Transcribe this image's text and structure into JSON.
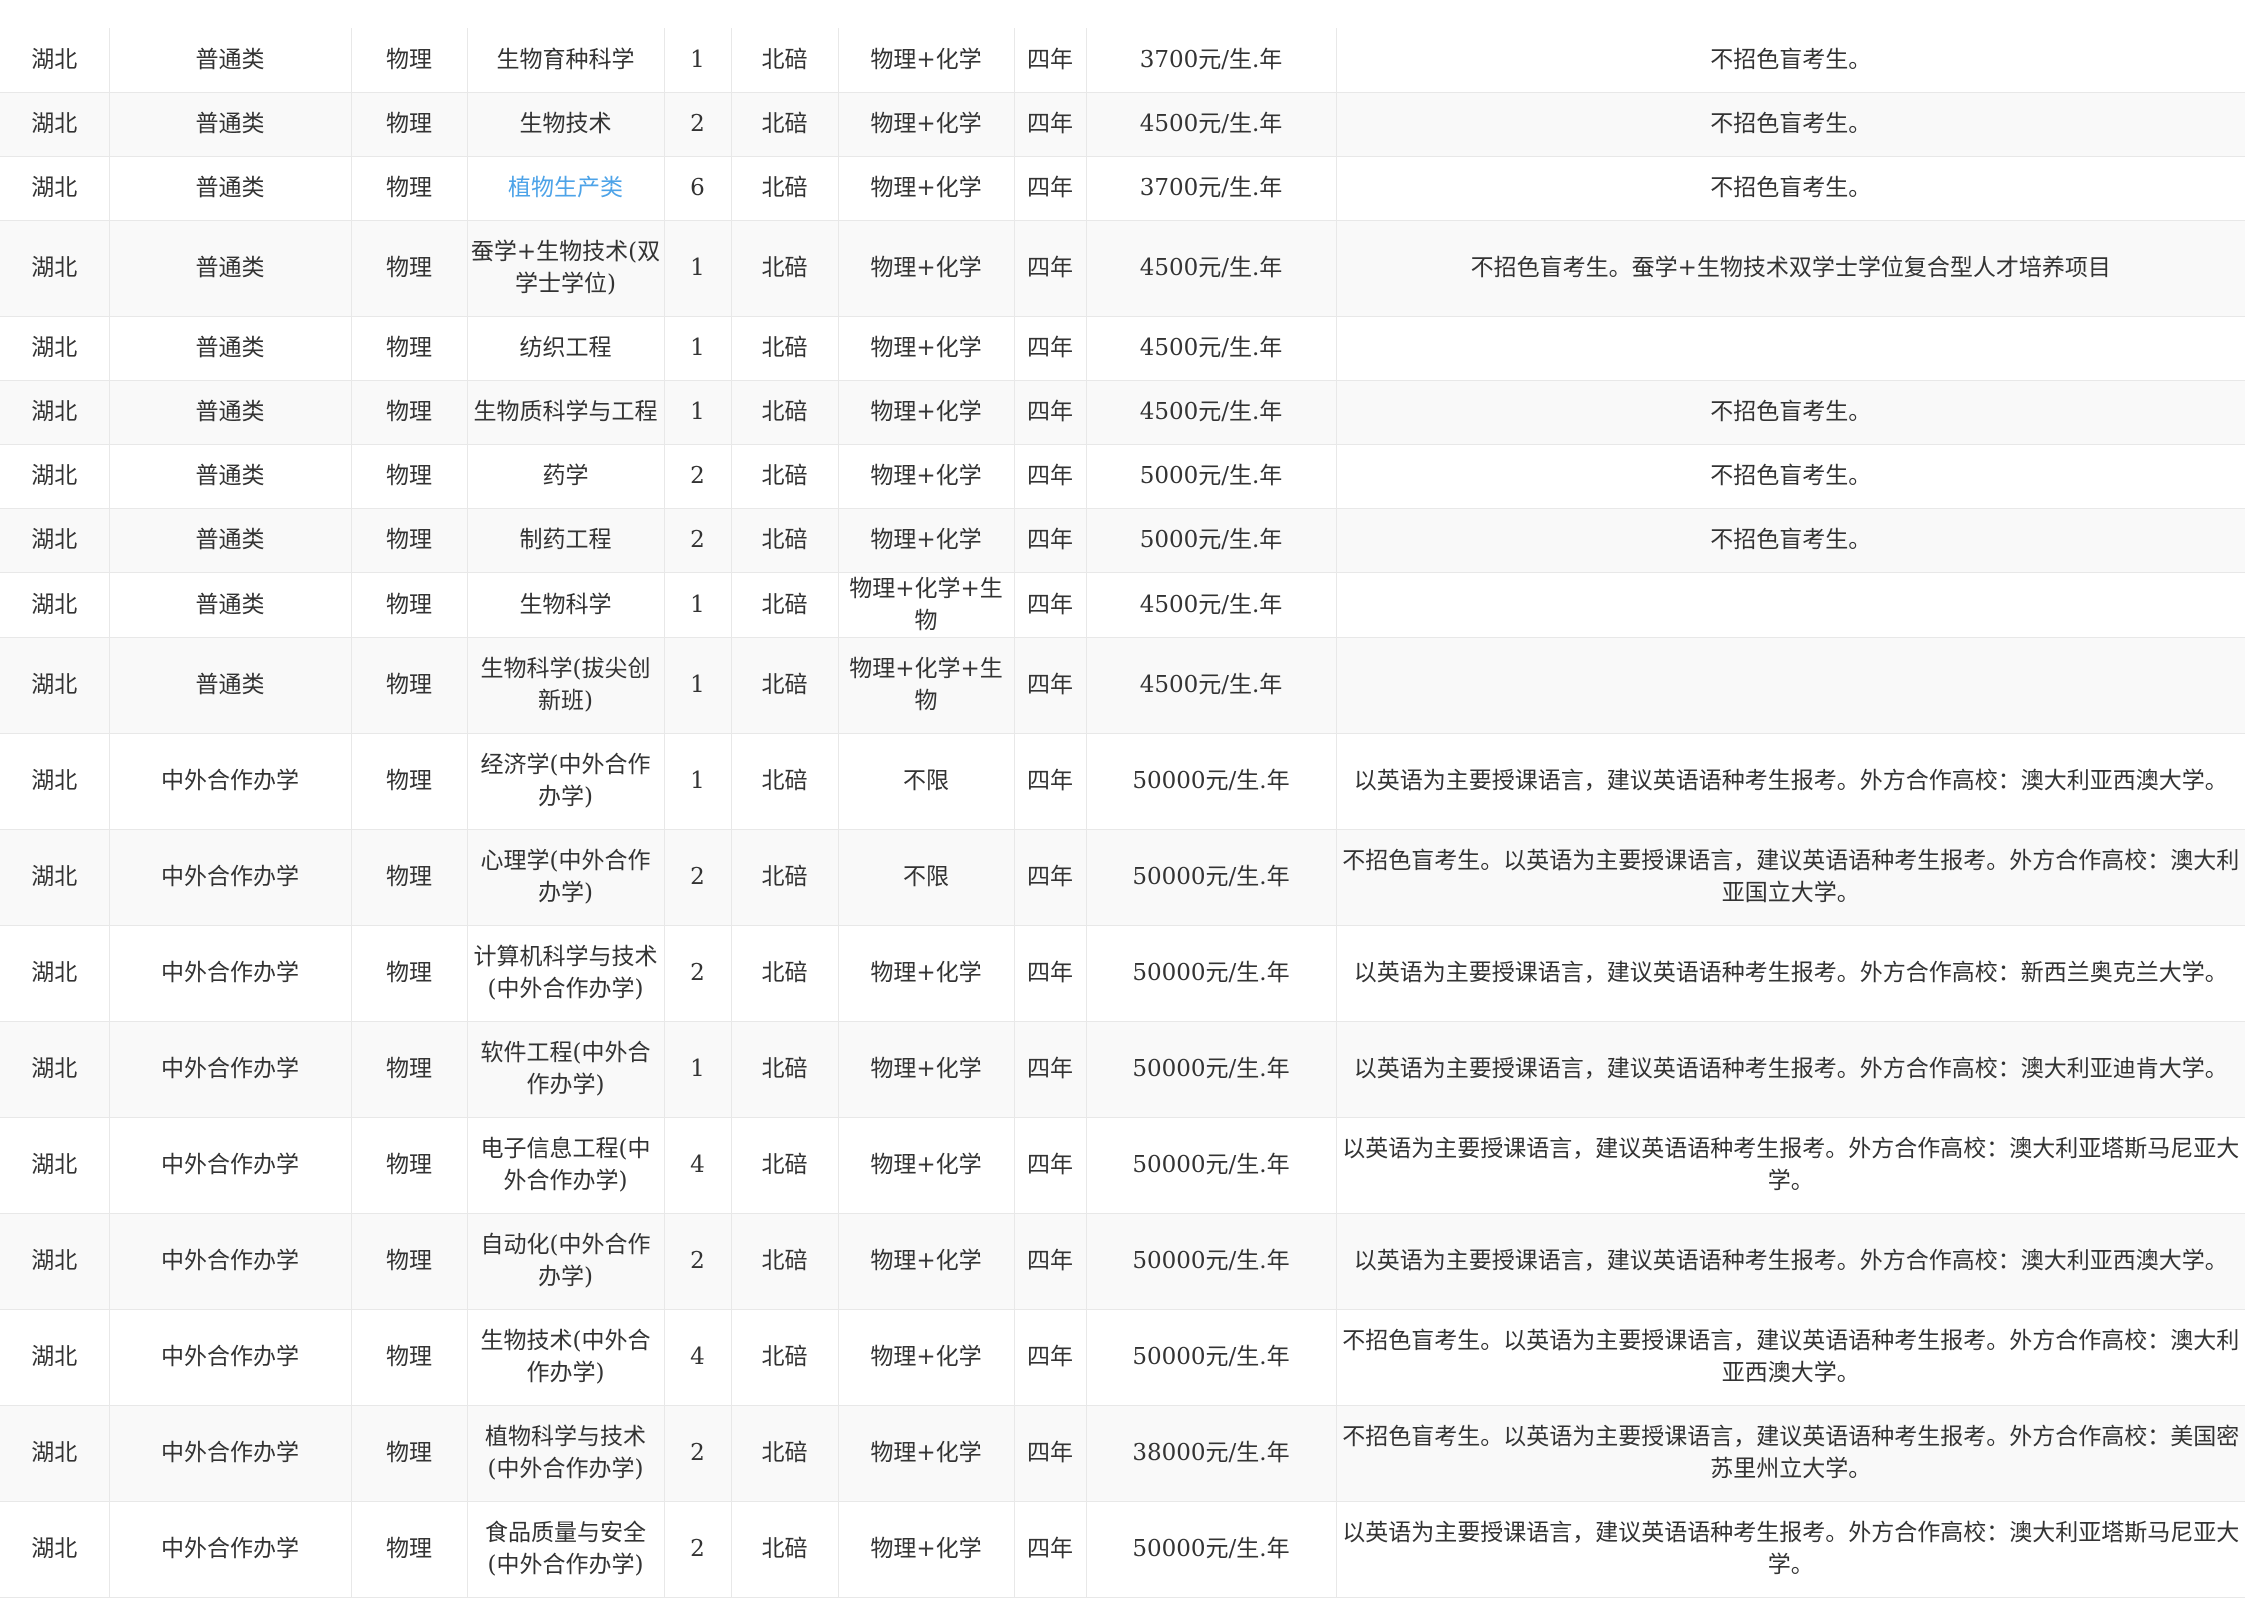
{
  "table": {
    "rows": [
      {
        "province": "湖北",
        "type": "普通类",
        "subject": "物理",
        "major": "生物育种科学",
        "plan": "1",
        "campus": "北碚",
        "requirement": "物理+化学",
        "duration": "四年",
        "fee": "3700元/生.年",
        "note": "不招色盲考生。",
        "is_link": false,
        "h": 64
      },
      {
        "province": "湖北",
        "type": "普通类",
        "subject": "物理",
        "major": "生物技术",
        "plan": "2",
        "campus": "北碚",
        "requirement": "物理+化学",
        "duration": "四年",
        "fee": "4500元/生.年",
        "note": "不招色盲考生。",
        "is_link": false,
        "h": 64
      },
      {
        "province": "湖北",
        "type": "普通类",
        "subject": "物理",
        "major": "植物生产类",
        "plan": "6",
        "campus": "北碚",
        "requirement": "物理+化学",
        "duration": "四年",
        "fee": "3700元/生.年",
        "note": "不招色盲考生。",
        "is_link": true,
        "h": 64
      },
      {
        "province": "湖北",
        "type": "普通类",
        "subject": "物理",
        "major": "蚕学+生物技术(双学士学位)",
        "plan": "1",
        "campus": "北碚",
        "requirement": "物理+化学",
        "duration": "四年",
        "fee": "4500元/生.年",
        "note": "不招色盲考生。蚕学+生物技术双学士学位复合型人才培养项目",
        "is_link": false,
        "h": 96
      },
      {
        "province": "湖北",
        "type": "普通类",
        "subject": "物理",
        "major": "纺织工程",
        "plan": "1",
        "campus": "北碚",
        "requirement": "物理+化学",
        "duration": "四年",
        "fee": "4500元/生.年",
        "note": "",
        "is_link": false,
        "h": 64
      },
      {
        "province": "湖北",
        "type": "普通类",
        "subject": "物理",
        "major": "生物质科学与工程",
        "plan": "1",
        "campus": "北碚",
        "requirement": "物理+化学",
        "duration": "四年",
        "fee": "4500元/生.年",
        "note": "不招色盲考生。",
        "is_link": false,
        "h": 64
      },
      {
        "province": "湖北",
        "type": "普通类",
        "subject": "物理",
        "major": "药学",
        "plan": "2",
        "campus": "北碚",
        "requirement": "物理+化学",
        "duration": "四年",
        "fee": "5000元/生.年",
        "note": "不招色盲考生。",
        "is_link": false,
        "h": 64
      },
      {
        "province": "湖北",
        "type": "普通类",
        "subject": "物理",
        "major": "制药工程",
        "plan": "2",
        "campus": "北碚",
        "requirement": "物理+化学",
        "duration": "四年",
        "fee": "5000元/生.年",
        "note": "不招色盲考生。",
        "is_link": false,
        "h": 64
      },
      {
        "province": "湖北",
        "type": "普通类",
        "subject": "物理",
        "major": "生物科学",
        "plan": "1",
        "campus": "北碚",
        "requirement": "物理+化学+生物",
        "duration": "四年",
        "fee": "4500元/生.年",
        "note": "",
        "is_link": false,
        "h": 64
      },
      {
        "province": "湖北",
        "type": "普通类",
        "subject": "物理",
        "major": "生物科学(拔尖创新班)",
        "plan": "1",
        "campus": "北碚",
        "requirement": "物理+化学+生物",
        "duration": "四年",
        "fee": "4500元/生.年",
        "note": "",
        "is_link": false,
        "h": 96
      },
      {
        "province": "湖北",
        "type": "中外合作办学",
        "subject": "物理",
        "major": "经济学(中外合作办学)",
        "plan": "1",
        "campus": "北碚",
        "requirement": "不限",
        "duration": "四年",
        "fee": "50000元/生.年",
        "note": "以英语为主要授课语言，建议英语语种考生报考。外方合作高校：澳大利亚西澳大学。",
        "is_link": false,
        "h": 96
      },
      {
        "province": "湖北",
        "type": "中外合作办学",
        "subject": "物理",
        "major": "心理学(中外合作办学)",
        "plan": "2",
        "campus": "北碚",
        "requirement": "不限",
        "duration": "四年",
        "fee": "50000元/生.年",
        "note": "不招色盲考生。以英语为主要授课语言，建议英语语种考生报考。外方合作高校：澳大利亚国立大学。",
        "is_link": false,
        "h": 96
      },
      {
        "province": "湖北",
        "type": "中外合作办学",
        "subject": "物理",
        "major": "计算机科学与技术(中外合作办学)",
        "plan": "2",
        "campus": "北碚",
        "requirement": "物理+化学",
        "duration": "四年",
        "fee": "50000元/生.年",
        "note": "以英语为主要授课语言，建议英语语种考生报考。外方合作高校：新西兰奥克兰大学。",
        "is_link": false,
        "h": 96
      },
      {
        "province": "湖北",
        "type": "中外合作办学",
        "subject": "物理",
        "major": "软件工程(中外合作办学)",
        "plan": "1",
        "campus": "北碚",
        "requirement": "物理+化学",
        "duration": "四年",
        "fee": "50000元/生.年",
        "note": "以英语为主要授课语言，建议英语语种考生报考。外方合作高校：澳大利亚迪肯大学。",
        "is_link": false,
        "h": 96
      },
      {
        "province": "湖北",
        "type": "中外合作办学",
        "subject": "物理",
        "major": "电子信息工程(中外合作办学)",
        "plan": "4",
        "campus": "北碚",
        "requirement": "物理+化学",
        "duration": "四年",
        "fee": "50000元/生.年",
        "note": "以英语为主要授课语言，建议英语语种考生报考。外方合作高校：澳大利亚塔斯马尼亚大学。",
        "is_link": false,
        "h": 96
      },
      {
        "province": "湖北",
        "type": "中外合作办学",
        "subject": "物理",
        "major": "自动化(中外合作办学)",
        "plan": "2",
        "campus": "北碚",
        "requirement": "物理+化学",
        "duration": "四年",
        "fee": "50000元/生.年",
        "note": "以英语为主要授课语言，建议英语语种考生报考。外方合作高校：澳大利亚西澳大学。",
        "is_link": false,
        "h": 96
      },
      {
        "province": "湖北",
        "type": "中外合作办学",
        "subject": "物理",
        "major": "生物技术(中外合作办学)",
        "plan": "4",
        "campus": "北碚",
        "requirement": "物理+化学",
        "duration": "四年",
        "fee": "50000元/生.年",
        "note": "不招色盲考生。以英语为主要授课语言，建议英语语种考生报考。外方合作高校：澳大利亚西澳大学。",
        "is_link": false,
        "h": 96
      },
      {
        "province": "湖北",
        "type": "中外合作办学",
        "subject": "物理",
        "major": "植物科学与技术(中外合作办学)",
        "plan": "2",
        "campus": "北碚",
        "requirement": "物理+化学",
        "duration": "四年",
        "fee": "38000元/生.年",
        "note": "不招色盲考生。以英语为主要授课语言，建议英语语种考生报考。外方合作高校：美国密苏里州立大学。",
        "is_link": false,
        "h": 96
      },
      {
        "province": "湖北",
        "type": "中外合作办学",
        "subject": "物理",
        "major": "食品质量与安全(中外合作办学)",
        "plan": "2",
        "campus": "北碚",
        "requirement": "物理+化学",
        "duration": "四年",
        "fee": "50000元/生.年",
        "note": "以英语为主要授课语言，建议英语语种考生报考。外方合作高校：澳大利亚塔斯马尼亚大学。",
        "is_link": false,
        "h": 96
      }
    ]
  }
}
